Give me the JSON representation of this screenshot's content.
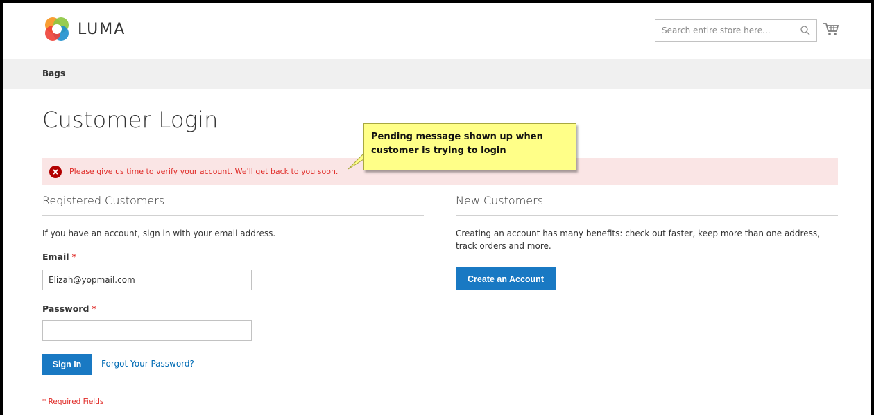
{
  "header": {
    "logo_text": "LUMA",
    "search_placeholder": "Search entire store here...",
    "search_icon": "search-icon",
    "cart_icon": "cart-icon"
  },
  "nav": {
    "items": [
      {
        "label": "Bags"
      }
    ]
  },
  "page": {
    "title": "Customer Login"
  },
  "message": {
    "type": "error",
    "text": "Please give us time to verify your account. We'll get back to you soon."
  },
  "callout": {
    "text": "Pending message shown up when customer is trying to login"
  },
  "registered": {
    "title": "Registered Customers",
    "intro": "If you have an account, sign in with your email address.",
    "email_label": "Email",
    "email_value": "Elizah@yopmail.com",
    "password_label": "Password",
    "password_value": "",
    "required_mark": "*",
    "sign_in_label": "Sign In",
    "forgot_label": "Forgot Your Password?",
    "required_note": "* Required Fields"
  },
  "new_customers": {
    "title": "New Customers",
    "intro": "Creating an account has many benefits: check out faster, keep more than one address, track orders and more.",
    "create_label": "Create an Account"
  },
  "colors": {
    "primary": "#1979c3",
    "link": "#006bb4",
    "error_text": "#e02b27",
    "error_bg": "#fae5e5",
    "callout_bg": "#ffff88",
    "nav_bg": "#f0f0f0"
  }
}
